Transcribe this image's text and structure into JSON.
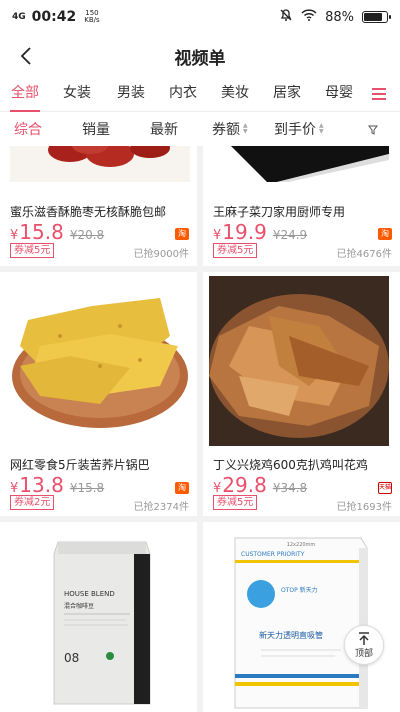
{
  "status": {
    "signal": "4G",
    "time": "00:42",
    "net_speed": "150",
    "net_unit": "KB/s",
    "battery": "88%",
    "battery_level": 0.88
  },
  "nav": {
    "title": "视频单"
  },
  "categories": {
    "active_color": "#e8506b",
    "items": [
      {
        "label": "全部",
        "active": true
      },
      {
        "label": "女装"
      },
      {
        "label": "男装"
      },
      {
        "label": "内衣"
      },
      {
        "label": "美妆"
      },
      {
        "label": "居家"
      },
      {
        "label": "母婴"
      }
    ]
  },
  "sort": {
    "items": [
      {
        "label": "综合",
        "active": true
      },
      {
        "label": "销量"
      },
      {
        "label": "最新"
      },
      {
        "label": "券额",
        "sortable": true
      },
      {
        "label": "到手价",
        "sortable": true
      }
    ]
  },
  "products": [
    {
      "title": "蜜乐滋香酥脆枣无核酥脆包邮",
      "yen": "¥",
      "price": "15.8",
      "original": "¥20.8",
      "coupon": "券减5元",
      "sold": "已抢9000件",
      "platform": "淘"
    },
    {
      "title": "王麻子菜刀家用厨师专用",
      "yen": "¥",
      "price": "19.9",
      "original": "¥24.9",
      "coupon": "券减5元",
      "sold": "已抢4676件",
      "platform": "淘"
    },
    {
      "title": "网红零食5斤装苦荞片锅巴",
      "yen": "¥",
      "price": "13.8",
      "original": "¥15.8",
      "coupon": "券减2元",
      "sold": "已抢2374件",
      "platform": "淘"
    },
    {
      "title": "丁义兴烧鸡600克扒鸡叫花鸡",
      "yen": "¥",
      "price": "29.8",
      "original": "¥34.8",
      "coupon": "券减5元",
      "sold": "已抢1693件",
      "platform": "天猫"
    },
    {
      "package_text": [
        "HOUSE BLEND",
        "混合咖啡豆",
        "08"
      ]
    },
    {
      "package_text": [
        "12x220mm",
        "CUSTOMER PRIORITY",
        "OTOP 新天力",
        "新天力透明直吸管"
      ]
    }
  ],
  "back_to_top": "顶部"
}
